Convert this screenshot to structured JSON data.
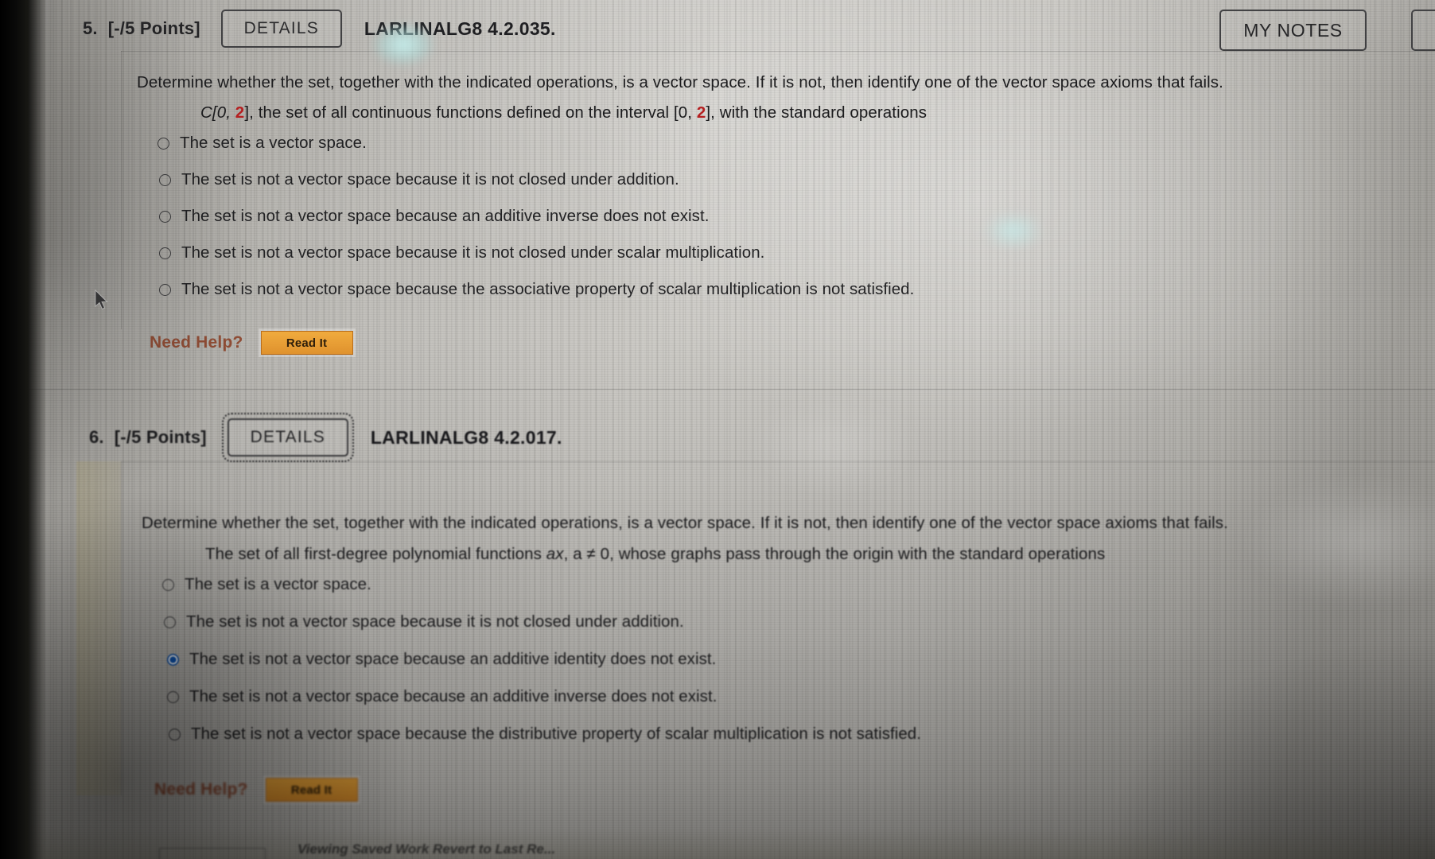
{
  "page": {
    "footer_note": "Viewing Saved Work Revert to Last Re..."
  },
  "toolbar": {
    "my_notes_label": "MY NOTES"
  },
  "questions": [
    {
      "number": "5.",
      "points": "[-/5 Points]",
      "details_label": "DETAILS",
      "code": "LARLINALG8 4.2.035.",
      "prompt": "Determine whether the set, together with the indicated operations, is a vector space. If it is not, then identify one of the vector space axioms that fails.",
      "subprompt_parts": {
        "a": "C[0, ",
        "b": "2",
        "c": "], the set of all continuous functions defined on the interval [0, ",
        "d": "2",
        "e": "], with the standard operations"
      },
      "options": [
        {
          "label": "The set is a vector space.",
          "selected": false
        },
        {
          "label": "The set is not a vector space because it is not closed under addition.",
          "selected": false
        },
        {
          "label": "The set is not a vector space because an additive inverse does not exist.",
          "selected": false
        },
        {
          "label": "The set is not a vector space because it is not closed under scalar multiplication.",
          "selected": false
        },
        {
          "label": "The set is not a vector space because the associative property of scalar multiplication is not satisfied.",
          "selected": false
        }
      ],
      "help_label": "Need Help?",
      "read_it_label": "Read It"
    },
    {
      "number": "6.",
      "points": "[-/5 Points]",
      "details_label": "DETAILS",
      "code": "LARLINALG8 4.2.017.",
      "prompt": "Determine whether the set, together with the indicated operations, is a vector space. If it is not, then identify one of the vector space axioms that fails.",
      "subprompt_parts": {
        "a": "The set of all first-degree polynomial functions ",
        "b": "ax",
        "c": ", a ≠ 0, whose graphs pass through the origin with the standard operations"
      },
      "options": [
        {
          "label": "The set is a vector space.",
          "selected": false
        },
        {
          "label": "The set is not a vector space because it is not closed under addition.",
          "selected": false
        },
        {
          "label": "The set is not a vector space because an additive identity does not exist.",
          "selected": true
        },
        {
          "label": "The set is not a vector space because an additive inverse does not exist.",
          "selected": false
        },
        {
          "label": "The set is not a vector space because the distributive property of scalar multiplication is not satisfied.",
          "selected": false
        }
      ],
      "help_label": "Need Help?",
      "read_it_label": "Read It"
    }
  ],
  "colors": {
    "highlight_red": "#b51f20",
    "help_brown": "#8e4a32",
    "read_it_orange": "#e8a033",
    "radio_selected_blue": "#0d55b4"
  }
}
